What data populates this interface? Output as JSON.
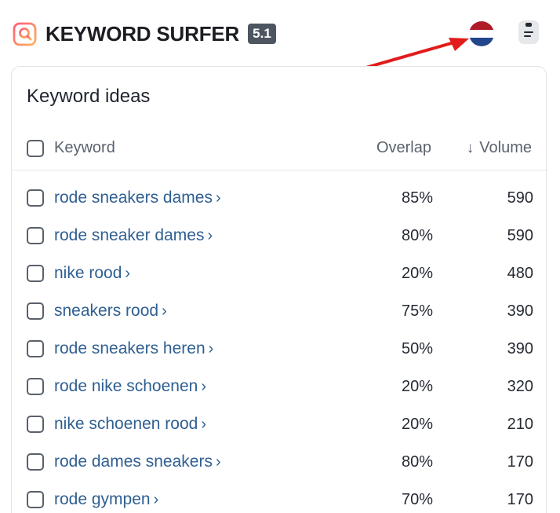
{
  "app": {
    "brand": "KEYWORD SURFER",
    "version": "5.1",
    "flag": {
      "icon": "netherlands-flag-icon",
      "colors": [
        "#ae1c28",
        "#ffffff",
        "#21468b"
      ]
    },
    "menu_icon": "sidebar-menu-icon"
  },
  "annotation": {
    "arrow_color": "#e31b1b"
  },
  "panel": {
    "title": "Keyword ideas",
    "columns": {
      "keyword": "Keyword",
      "overlap": "Overlap",
      "volume": "Volume",
      "volume_sort_icon": "↓"
    },
    "rows": [
      {
        "keyword": "rode sneakers dames",
        "overlap": "85%",
        "volume": "590"
      },
      {
        "keyword": "rode sneaker dames",
        "overlap": "80%",
        "volume": "590"
      },
      {
        "keyword": "nike rood",
        "overlap": "20%",
        "volume": "480"
      },
      {
        "keyword": "sneakers rood",
        "overlap": "75%",
        "volume": "390"
      },
      {
        "keyword": "rode sneakers heren",
        "overlap": "50%",
        "volume": "390"
      },
      {
        "keyword": "rode nike schoenen",
        "overlap": "20%",
        "volume": "320"
      },
      {
        "keyword": "nike schoenen rood",
        "overlap": "20%",
        "volume": "210"
      },
      {
        "keyword": "rode dames sneakers",
        "overlap": "80%",
        "volume": "170"
      },
      {
        "keyword": "rode gympen",
        "overlap": "70%",
        "volume": "170"
      }
    ],
    "chevron": "›"
  },
  "colors": {
    "link": "#2f5f91",
    "brand_badge": "#4d5561",
    "logo_gradient_start": "#ff5e7a",
    "logo_gradient_end": "#ffb15c"
  }
}
